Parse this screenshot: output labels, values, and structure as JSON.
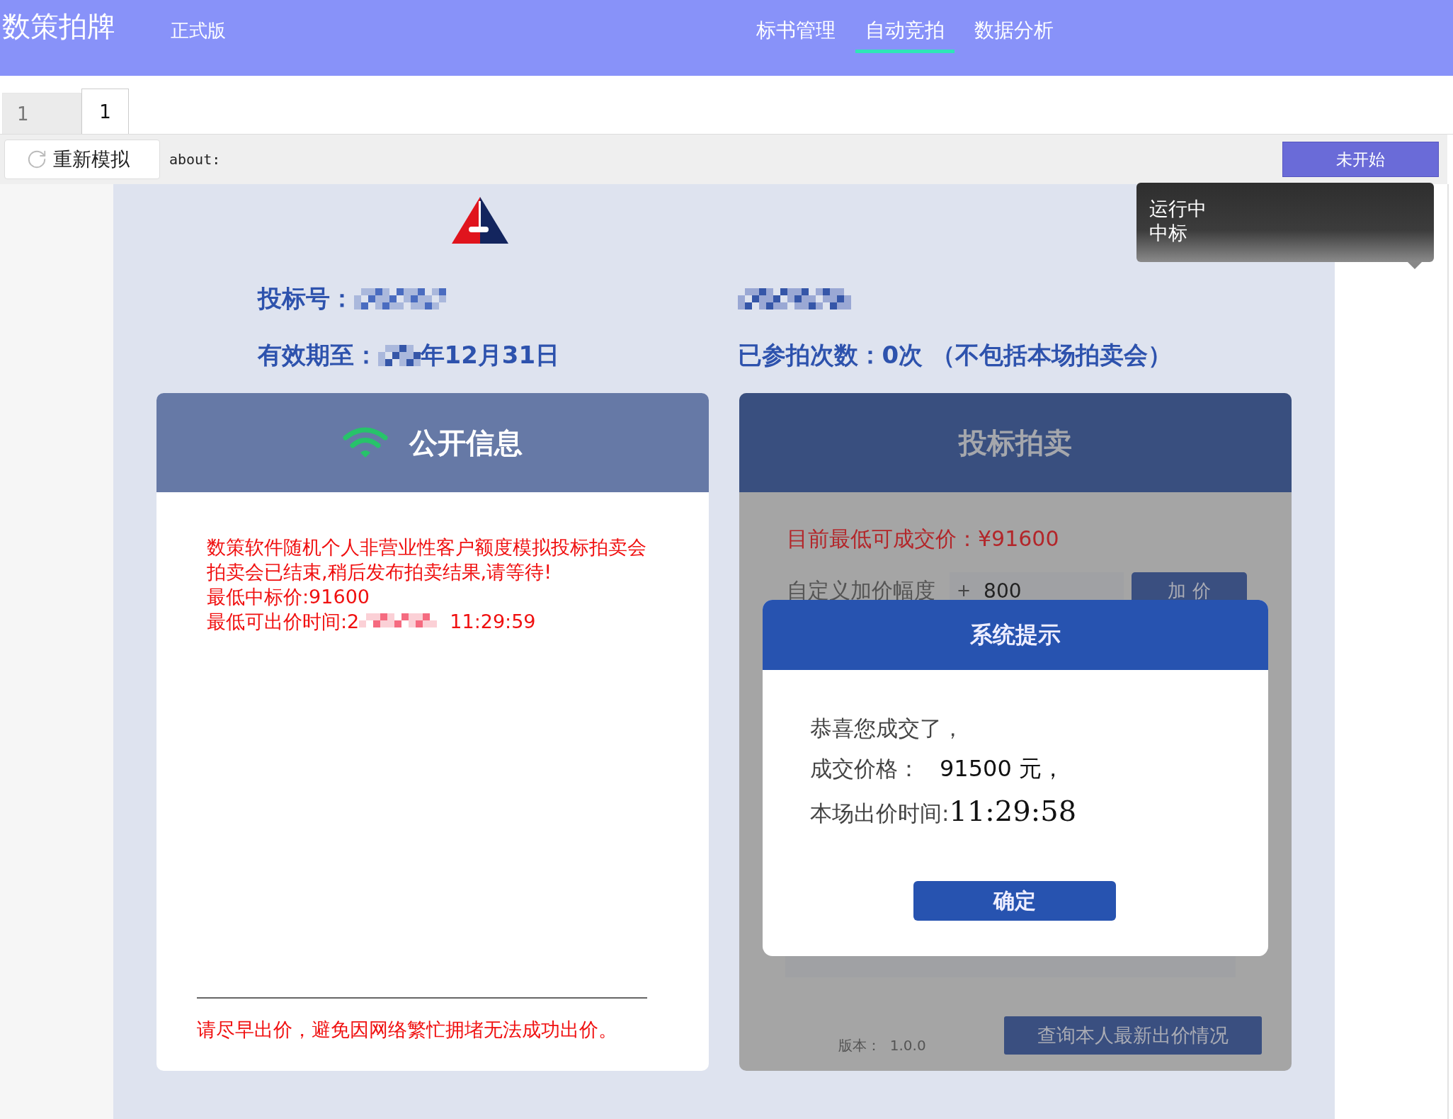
{
  "header": {
    "brand": "数策拍牌",
    "edition": "正式版",
    "nav": [
      {
        "label": "标书管理",
        "selected": false
      },
      {
        "label": "自动竞拍",
        "selected": true
      },
      {
        "label": "数据分析",
        "selected": false
      }
    ]
  },
  "tabs": [
    {
      "label": "1",
      "selected": false
    },
    {
      "label": "1",
      "selected": true
    }
  ],
  "toolbar": {
    "reload_button": "重新模拟",
    "address": "about:",
    "status_button": "未开始"
  },
  "tooltip": {
    "lines": [
      "运行中",
      "中标"
    ]
  },
  "bid_info": {
    "bid_number_label": "投标号：",
    "expiry_label": "有效期至：",
    "expiry_value": "年12月31日",
    "count": "已参拍次数：0次 （不包括本场拍卖会）"
  },
  "public_info": {
    "title": "公开信息",
    "lines": [
      {
        "text": "数策软件随机个人非营业性客户额度模拟投标拍卖会"
      },
      {
        "text": "拍卖会已结束,稍后发布拍卖结果,请等待!"
      },
      {
        "text": "最低中标价:91600"
      },
      {
        "text": "最低可出价时间:2",
        "suffix": "11:29:59"
      }
    ],
    "footer": "请尽早出价，避免因网络繁忙拥堵无法成功出价。"
  },
  "auction": {
    "title": "投标拍卖",
    "lowest_price": "目前最低可成交价：¥91600",
    "increment_label": "自定义加价幅度",
    "increment_prefix": "+",
    "increment_value": "800",
    "add_button": "加 价",
    "version_label": "版本：",
    "version": "1.0.0",
    "query_button": "查询本人最新出价情况"
  },
  "dialog": {
    "title": "系统提示",
    "lines": [
      {
        "label": "恭喜您成交了，"
      },
      {
        "label": "成交价格：",
        "value": "91500 元，",
        "kind": "price"
      },
      {
        "label": "本场出价时间:",
        "value": "11:29:58",
        "kind": "time"
      }
    ],
    "confirm_button": "确定"
  }
}
